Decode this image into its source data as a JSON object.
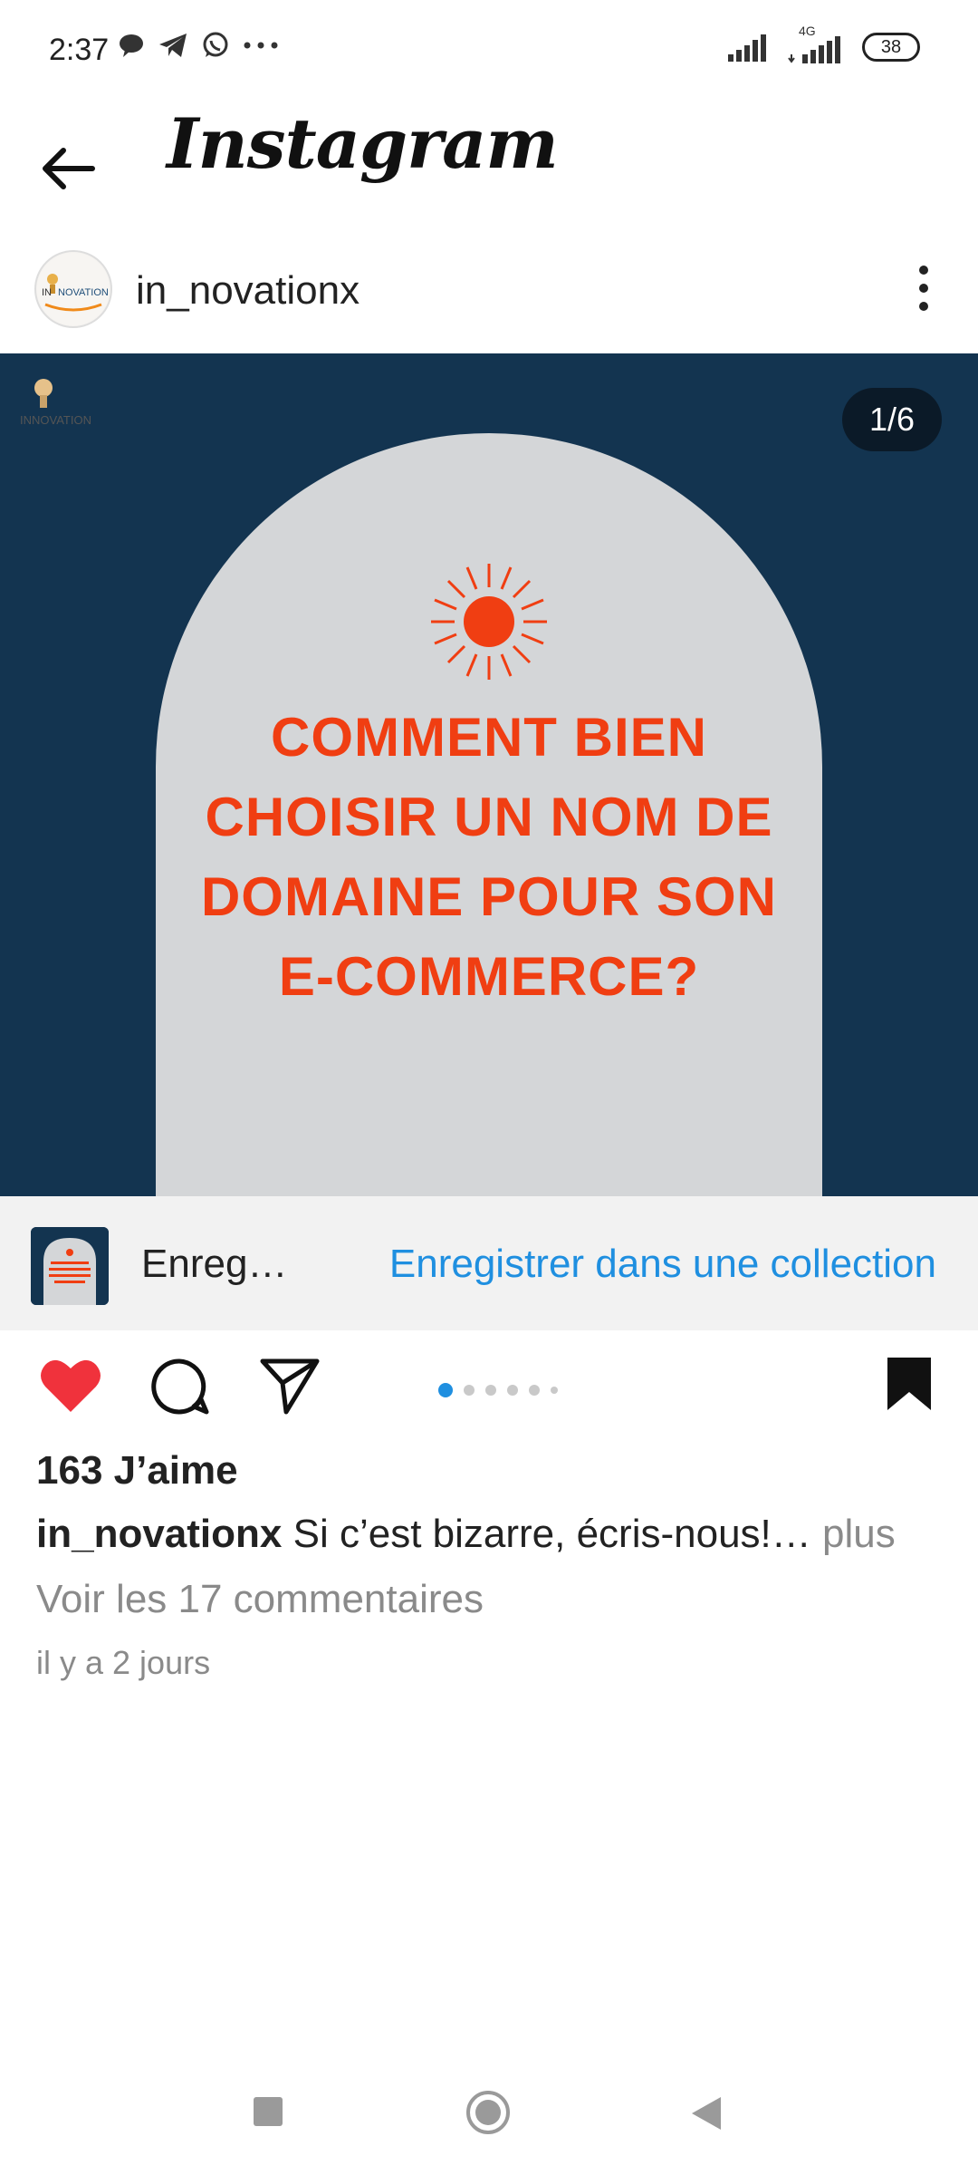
{
  "status": {
    "time": "2:37",
    "battery": "38",
    "network": "4G"
  },
  "header": {
    "title": "Instagram"
  },
  "post": {
    "username": "in_novationx",
    "slide_counter": "1/6",
    "headline_lines": [
      "COMMENT BIEN",
      "CHOISIR UN NOM DE",
      "DOMAINE POUR SON",
      "E-COMMERCE?"
    ],
    "image_logo_text": "INNOVATION"
  },
  "save_bar": {
    "label": "Enreg…",
    "collection_link": "Enregistrer dans une collection"
  },
  "engagement": {
    "likes": "163 J’aime",
    "caption_user": "in_novationx",
    "caption_text": " Si c’est bizarre, écris-nous!…",
    "caption_more": " plus",
    "comments_link": "Voir les 17 commentaires",
    "timestamp": "il y a 2 jours"
  },
  "colors": {
    "accent_blue": "#1f8fe0",
    "like_red": "#f0323c",
    "post_bg": "#133450",
    "headline": "#f03e12"
  }
}
